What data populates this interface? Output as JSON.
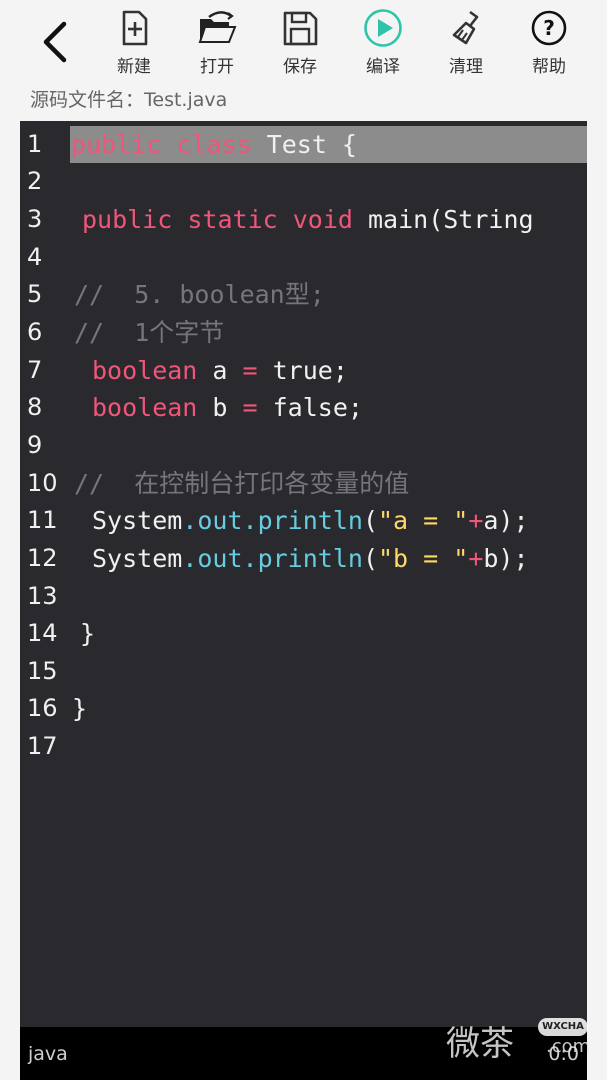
{
  "toolbar": {
    "back_icon": "chevron-left-icon",
    "items": [
      {
        "label": "新建",
        "icon": "new-file-icon"
      },
      {
        "label": "打开",
        "icon": "folder-open-icon"
      },
      {
        "label": "保存",
        "icon": "save-icon"
      },
      {
        "label": "编译",
        "icon": "play-icon",
        "color": "#2ec4a9"
      },
      {
        "label": "清理",
        "icon": "broom-icon"
      },
      {
        "label": "帮助",
        "icon": "help-icon"
      }
    ]
  },
  "file": {
    "label": "源码文件名：",
    "name": "Test.java"
  },
  "editor": {
    "current_line": 1,
    "lines": [
      {
        "num": "1"
      },
      {
        "num": "2"
      },
      {
        "num": "3"
      },
      {
        "num": "4"
      },
      {
        "num": "5"
      },
      {
        "num": "6"
      },
      {
        "num": "7"
      },
      {
        "num": "8"
      },
      {
        "num": "9"
      },
      {
        "num": "10"
      },
      {
        "num": "11"
      },
      {
        "num": "12"
      },
      {
        "num": "13"
      },
      {
        "num": "14"
      },
      {
        "num": "15"
      },
      {
        "num": "16"
      },
      {
        "num": "17"
      }
    ],
    "code": {
      "l1_kw": "public class",
      "l1_rest": " Test {",
      "l3_kw": "public static void",
      "l3_rest": " main(String",
      "l5": "//  5. boolean型;",
      "l6": "//  1个字节",
      "l7_kw": "boolean",
      "l7_var": " a ",
      "l7_op": "=",
      "l7_rest": " true;",
      "l8_kw": "boolean",
      "l8_var": " b ",
      "l8_op": "=",
      "l8_rest": " false;",
      "l10": "//  在控制台打印各变量的值",
      "l11_obj": "System",
      "l11_call": ".out.println",
      "l11_p1": "(",
      "l11_str": "\"a = \"",
      "l11_op": "+",
      "l11_rest": "a);",
      "l12_obj": "System",
      "l12_call": ".out.println",
      "l12_p1": "(",
      "l12_str": "\"b = \"",
      "l12_op": "+",
      "l12_rest": "b);",
      "l14": "}",
      "l16": "}"
    },
    "colors": {
      "background": "#2a292d",
      "keyword": "#f0557a",
      "comment": "#76767a",
      "method": "#66cce0",
      "string": "#ffd866",
      "line_highlight": "#8c8c8c"
    }
  },
  "status": {
    "language": "java",
    "position": "0:0"
  },
  "watermark": {
    "text": "微茶",
    "badge": "WXCHA",
    "suffix": ".com"
  }
}
